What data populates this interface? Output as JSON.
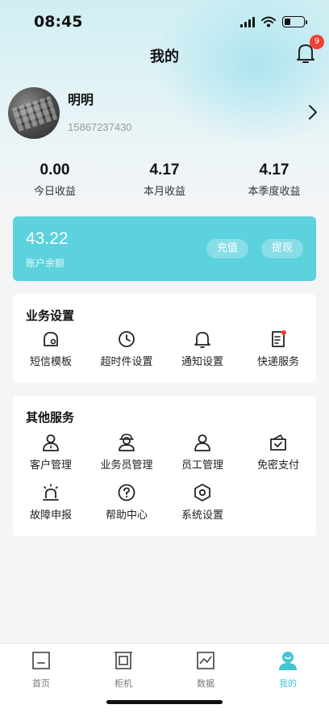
{
  "status_bar": {
    "time": "08:45"
  },
  "header": {
    "title": "我的",
    "notification_count": "9"
  },
  "profile": {
    "name": "明明",
    "phone": "15867237430"
  },
  "stats": [
    {
      "value": "0.00",
      "label": "今日收益"
    },
    {
      "value": "4.17",
      "label": "本月收益"
    },
    {
      "value": "4.17",
      "label": "本季度收益"
    }
  ],
  "balance": {
    "value": "43.22",
    "label": "账户余额",
    "recharge_label": "充值",
    "withdraw_label": "提现"
  },
  "business": {
    "title": "业务设置",
    "items": [
      {
        "label": "短信模板",
        "icon": "sms-template-icon"
      },
      {
        "label": "超时件设置",
        "icon": "clock-icon"
      },
      {
        "label": "通知设置",
        "icon": "bell-icon"
      },
      {
        "label": "快递服务",
        "icon": "courier-doc-icon"
      }
    ]
  },
  "other": {
    "title": "其他服务",
    "items": [
      {
        "label": "客户管理",
        "icon": "customer-icon"
      },
      {
        "label": "业务员管理",
        "icon": "salesman-icon"
      },
      {
        "label": "员工管理",
        "icon": "employee-icon"
      },
      {
        "label": "免密支付",
        "icon": "wallet-check-icon"
      },
      {
        "label": "故障申报",
        "icon": "alarm-icon"
      },
      {
        "label": "帮助中心",
        "icon": "help-icon"
      },
      {
        "label": "系统设置",
        "icon": "settings-hex-icon"
      }
    ]
  },
  "tabbar": {
    "items": [
      {
        "label": "首页",
        "icon": "home-icon"
      },
      {
        "label": "柜机",
        "icon": "locker-icon"
      },
      {
        "label": "数据",
        "icon": "chart-icon"
      },
      {
        "label": "我的",
        "icon": "profile-icon"
      }
    ],
    "active_index": 3
  },
  "colors": {
    "accent": "#5bd2dd",
    "tab_active": "#46c3d6",
    "badge": "#f04134"
  }
}
